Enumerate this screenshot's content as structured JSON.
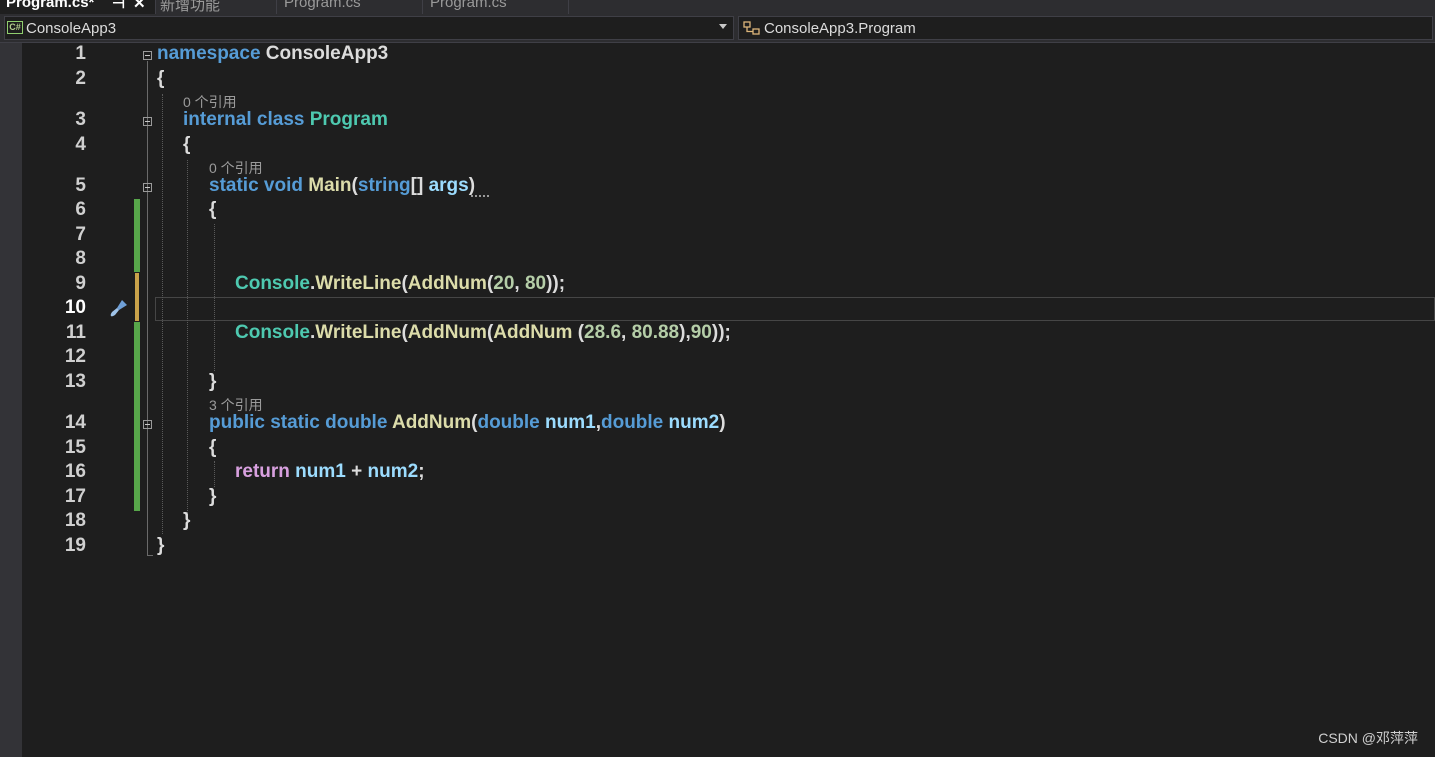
{
  "tabs": [
    {
      "label": "Program.cs*",
      "active": true
    },
    {
      "label": "新增功能",
      "active": false
    },
    {
      "label": "Program.cs",
      "active": false
    },
    {
      "label": "Program.cs",
      "active": false
    }
  ],
  "tab_controls": {
    "pin": "⊣",
    "close": "✕"
  },
  "navbar": {
    "project": "ConsoleApp3",
    "member": "ConsoleApp3.Program"
  },
  "line_numbers": [
    "1",
    "2",
    "3",
    "4",
    "5",
    "6",
    "7",
    "8",
    "9",
    "10",
    "11",
    "12",
    "13",
    "14",
    "15",
    "16",
    "17",
    "18",
    "19"
  ],
  "current_line": 10,
  "code_lens": {
    "class_refs": "0 个引用",
    "main_refs": "0 个引用",
    "addnum_refs": "3 个引用"
  },
  "code": {
    "l1_kw": "namespace",
    "l1_name": " ConsoleApp3",
    "l2": "{",
    "l3_kw": "internal class",
    "l3_name": " Program",
    "l4": "{",
    "l5_kw": "static void",
    "l5_fn": " Main",
    "l5_p1": "(",
    "l5_type": "string",
    "l5_p2": "[] ",
    "l5_arg": "args",
    "l5_p3": ")",
    "l6": "{",
    "l9_type": "Console",
    "l9_dot": ".",
    "l9_fn": "WriteLine",
    "l9_p1": "(",
    "l9_fn2": "AddNum",
    "l9_p2": "(",
    "l9_n1": "20",
    "l9_p3": ", ",
    "l9_n2": "80",
    "l9_p4": "));",
    "l11_type": "Console",
    "l11_dot": ".",
    "l11_fn": "WriteLine",
    "l11_p1": "(",
    "l11_fn2": "AddNum",
    "l11_p2": "(",
    "l11_fn3": "AddNum",
    "l11_p3": " (",
    "l11_n1": "28.6",
    "l11_p4": ", ",
    "l11_n2": "80.88",
    "l11_p5": "),",
    "l11_n3": "90",
    "l11_p6": "));",
    "l13": "}",
    "l14_kw": "public static double",
    "l14_fn": " AddNum",
    "l14_p1": "(",
    "l14_t1": "double",
    "l14_a1": " num1",
    "l14_p2": ",",
    "l14_t2": "double",
    "l14_a2": " num2",
    "l14_p3": ")",
    "l15": "{",
    "l16_kw": "return",
    "l16_a1": " num1",
    "l16_op": " + ",
    "l16_a2": "num2",
    "l16_p": ";",
    "l17": "}",
    "l18": "}",
    "l19": "}"
  },
  "watermark": "CSDN @邓萍萍"
}
